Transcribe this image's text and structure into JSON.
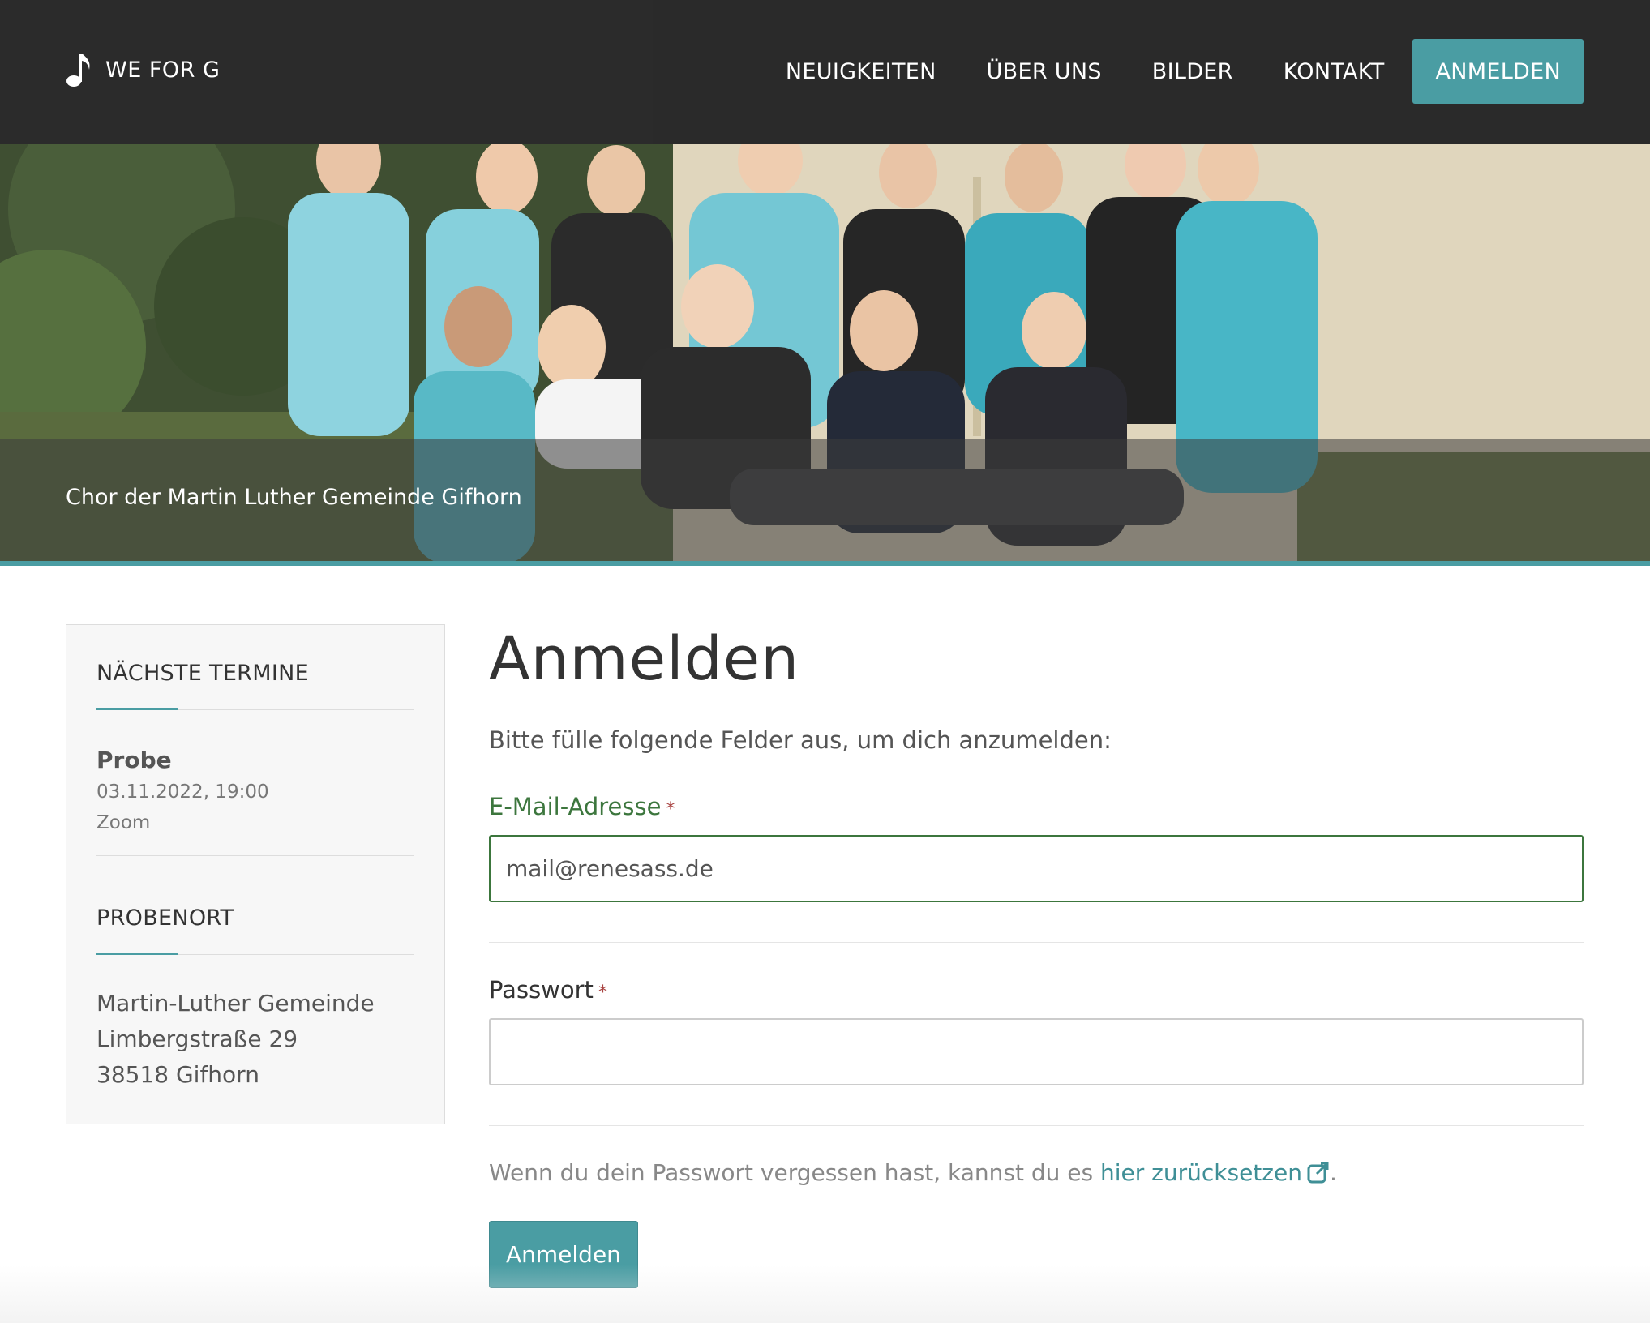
{
  "header": {
    "brand": "WE FOR G",
    "nav": [
      "NEUIGKEITEN",
      "ÜBER UNS",
      "BILDER",
      "KONTAKT"
    ],
    "login_button": "ANMELDEN"
  },
  "hero": {
    "caption": "Chor der Martin Luther Gemeinde Gifhorn"
  },
  "sidebar": {
    "events_heading": "NÄCHSTE TERMINE",
    "event": {
      "title": "Probe",
      "datetime": "03.11.2022, 19:00",
      "place": "Zoom"
    },
    "location_heading": "PROBENORT",
    "address": [
      "Martin-Luther Gemeinde",
      "Limbergstraße 29",
      "38518 Gifhorn"
    ]
  },
  "main": {
    "title": "Anmelden",
    "intro": "Bitte fülle folgende Felder aus, um dich anzumelden:",
    "email_label": "E-Mail-Adresse",
    "email_value": "mail@renesass.de",
    "password_label": "Passwort",
    "password_value": "",
    "required_mark": "*",
    "forgot_text": "Wenn du dein Passwort vergessen hast, kannst du es",
    "reset_link": "hier zurücksetzen",
    "forgot_end": ".",
    "submit_label": "Anmelden"
  },
  "colors": {
    "accent": "#4a9da3",
    "header_bg": "#2b2b2b",
    "success_green": "#3c763d",
    "required_red": "#a94442"
  }
}
